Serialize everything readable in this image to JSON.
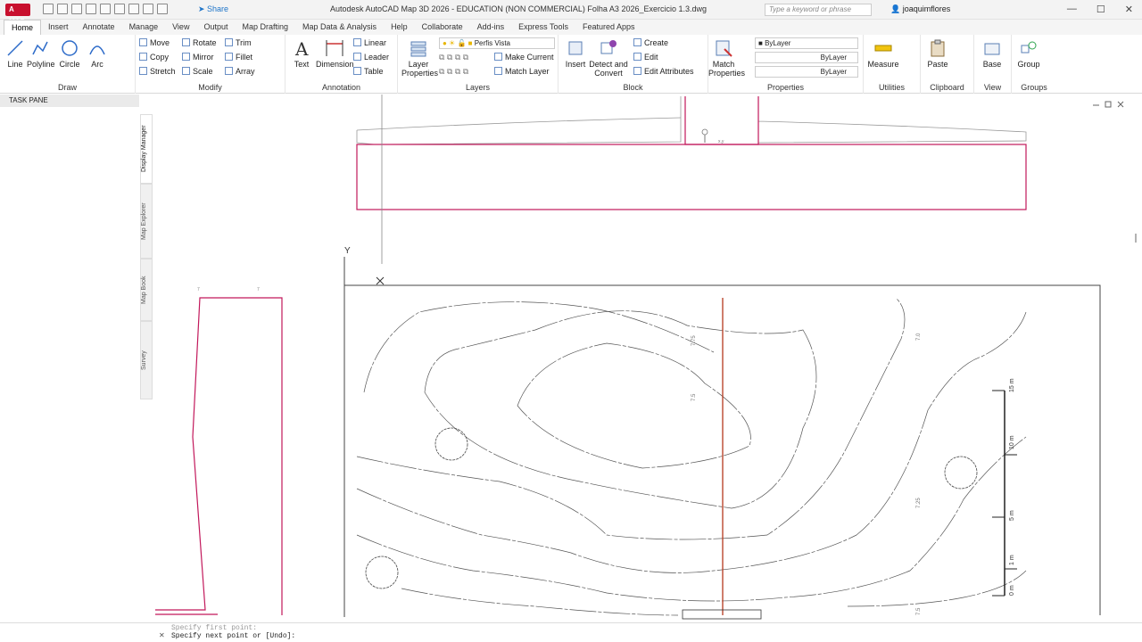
{
  "titlebar": {
    "app_label": "A MAP",
    "share": "Share",
    "title": "Autodesk AutoCAD Map 3D 2026 - EDUCATION (NON COMMERCIAL)   Folha A3 2026_Exercicio 1.3.dwg",
    "search_placeholder": "Type a keyword or phrase",
    "user": "joaquimflores"
  },
  "tabs": [
    "Home",
    "Insert",
    "Annotate",
    "Manage",
    "View",
    "Output",
    "Map Drafting",
    "Map Data & Analysis",
    "Help",
    "Collaborate",
    "Add-ins",
    "Express Tools",
    "Featured Apps"
  ],
  "ribbon": {
    "draw": {
      "title": "Draw",
      "line": "Line",
      "polyline": "Polyline",
      "circle": "Circle",
      "arc": "Arc"
    },
    "modify": {
      "title": "Modify",
      "move": "Move",
      "rotate": "Rotate",
      "trim": "Trim",
      "copy": "Copy",
      "mirror": "Mirror",
      "fillet": "Fillet",
      "stretch": "Stretch",
      "scale": "Scale",
      "array": "Array"
    },
    "annotation": {
      "title": "Annotation",
      "text": "Text",
      "dimension": "Dimension",
      "linear": "Linear",
      "leader": "Leader",
      "table": "Table"
    },
    "layers": {
      "title": "Layers",
      "layer_properties": "Layer Properties",
      "current_layer": "Perfis Vista",
      "make_current": "Make Current",
      "match_layer": "Match Layer"
    },
    "block": {
      "title": "Block",
      "insert": "Insert",
      "detect_convert": "Detect and Convert",
      "create": "Create",
      "edit": "Edit",
      "edit_attributes": "Edit Attributes"
    },
    "properties": {
      "title": "Properties",
      "match_properties": "Match Properties",
      "color": "ByLayer",
      "linetype": "ByLayer",
      "lineweight": "ByLayer"
    },
    "utilities": {
      "title": "Utilities",
      "measure": "Measure"
    },
    "clipboard": {
      "title": "Clipboard",
      "paste": "Paste"
    },
    "view": {
      "title": "View",
      "base": "Base"
    },
    "groups": {
      "title": "Groups",
      "group": "Group"
    }
  },
  "taskpane": {
    "header": "TASK PANE",
    "tabs": [
      "Display Manager",
      "Map Explorer",
      "Map Book",
      "Survey"
    ]
  },
  "drawing": {
    "ucs_y": "Y",
    "scale_labels": [
      "15 m",
      "10 m",
      "5 m",
      "1 m",
      "0 m"
    ],
    "contour_labels": [
      "7.75",
      "7.5",
      "7.0",
      "7.25",
      "7.5"
    ]
  },
  "command": {
    "previous": "Specify first point:",
    "current": "Specify next point or [Undo]:"
  },
  "colors": {
    "magenta": "#c2185b",
    "section_red": "#b5391e",
    "accent_blue": "#1f75c9"
  }
}
